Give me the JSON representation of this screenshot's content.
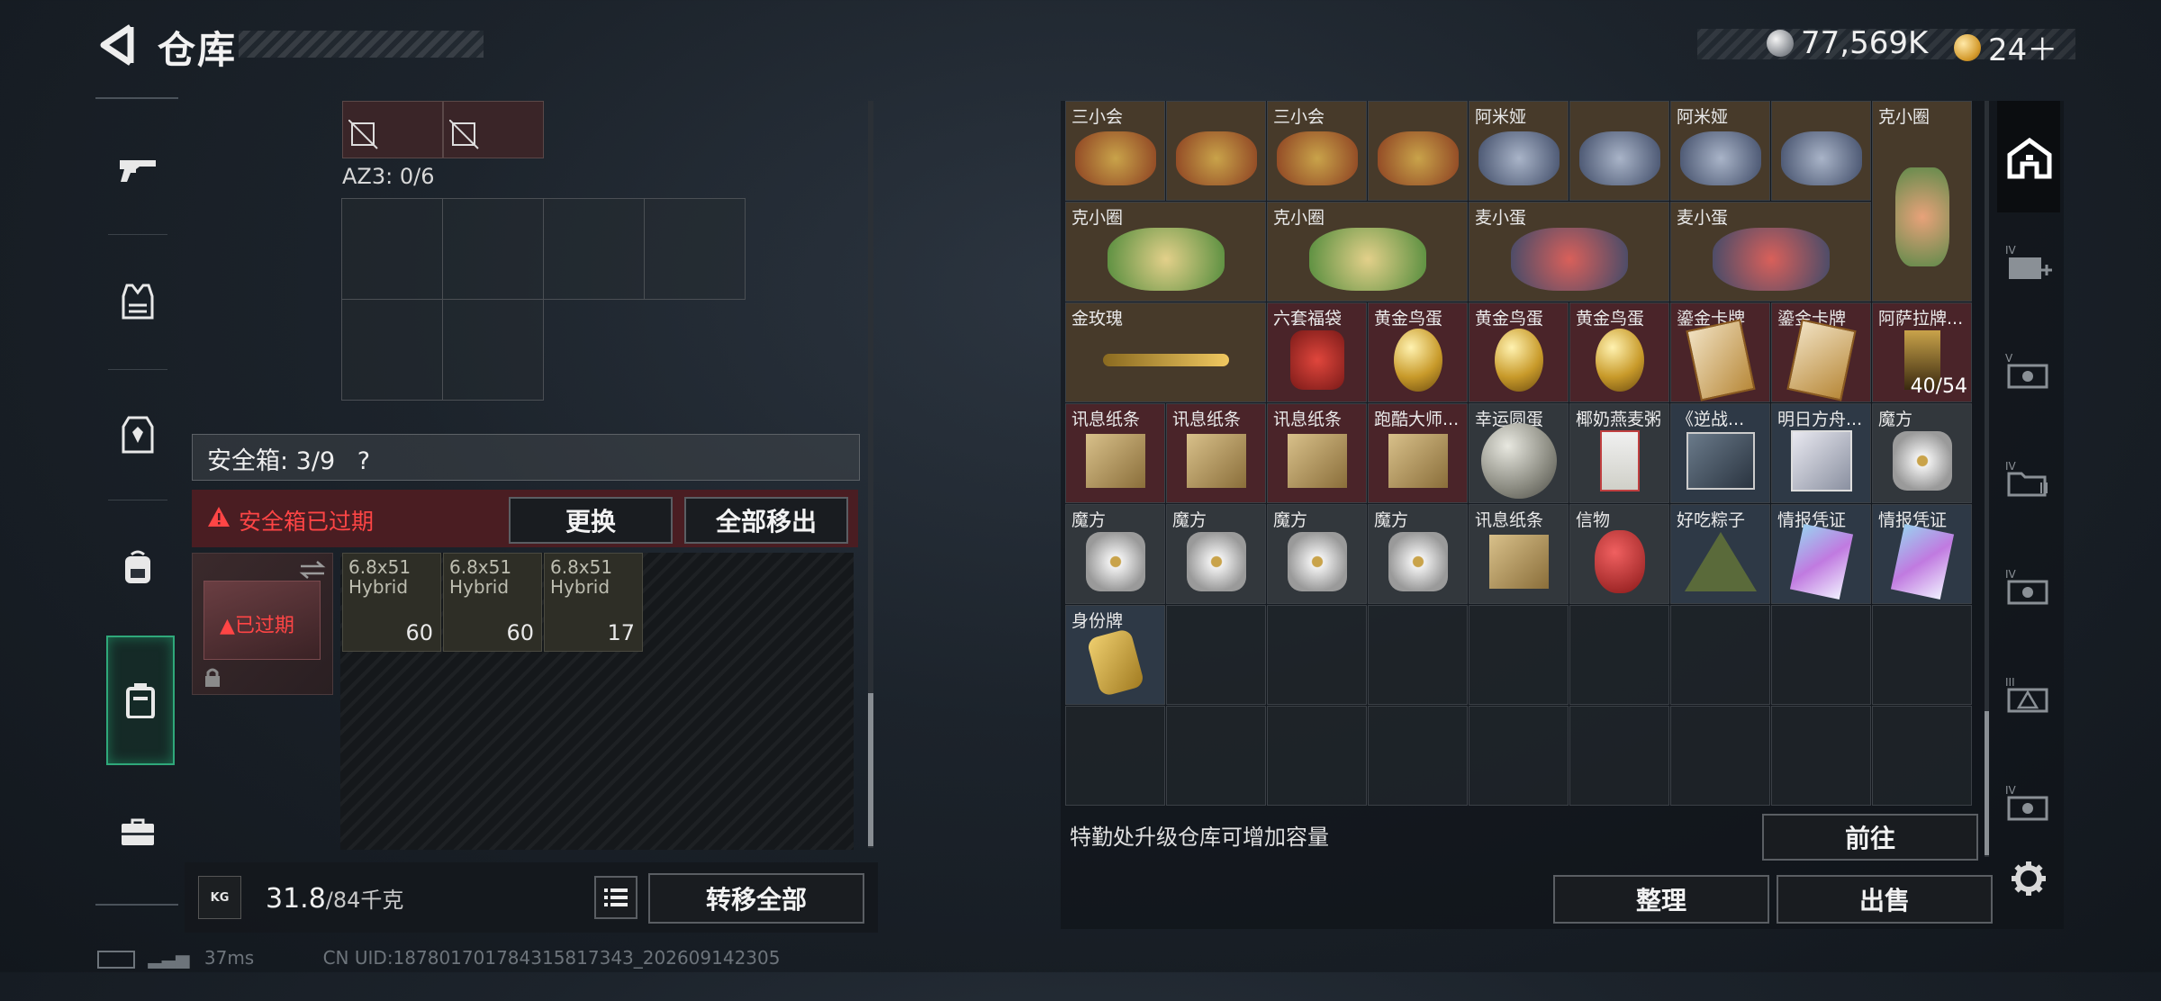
{
  "header": {
    "title": "仓库",
    "currency_silver": "77,569K",
    "currency_gold": "24＋"
  },
  "left_nav": {
    "items": [
      "gun-icon",
      "armor-vest-icon",
      "chest-rig-icon",
      "backpack-icon",
      "safebox-icon",
      "toolbox-icon"
    ]
  },
  "loadout": {
    "az3_label": "AZ3: 0/6",
    "safebox_label": "安全箱: 3/9",
    "safebox_help": "?",
    "expired_warning": "安全箱已过期",
    "replace_button": "更换",
    "move_all_out_button": "全部移出",
    "safebox_expired_tag": "已过期",
    "ammo": [
      {
        "name": "6.8x51\nHybrid",
        "count": "60"
      },
      {
        "name": "6.8x51\nHybrid",
        "count": "60"
      },
      {
        "name": "6.8x51\nHybrid",
        "count": "17"
      }
    ],
    "weight_value": "31.8",
    "weight_max": "/84千克",
    "weight_icon_text": "KG",
    "transfer_all_button": "转移全部"
  },
  "status": {
    "ping": "37ms",
    "uid": "CN UID:187801701784315817343_202609142305"
  },
  "inventory": {
    "rows": [
      [
        "三小会",
        "三小会",
        "阿米娅",
        "阿米娅",
        "克小圈"
      ],
      [
        "克小圈",
        "克小圈",
        "麦小蛋",
        "麦小蛋"
      ],
      [
        "金玫瑰",
        "六套福袋",
        "黄金鸟蛋",
        "黄金鸟蛋",
        "黄金鸟蛋",
        "鎏金卡牌",
        "鎏金卡牌",
        "阿萨拉牌..."
      ],
      [
        "讯息纸条",
        "讯息纸条",
        "讯息纸条",
        "跑酷大师...",
        "幸运圆蛋",
        "椰奶燕麦粥",
        "《逆战...",
        "明日方舟...",
        "魔方"
      ],
      [
        "魔方",
        "魔方",
        "魔方",
        "魔方",
        "讯息纸条",
        "信物",
        "好吃粽子",
        "情报凭证",
        "情报凭证"
      ],
      [
        "身份牌"
      ]
    ],
    "tall_item_count": "40/54",
    "upgrade_hint": "特勤处升级仓库可增加容量",
    "goto_button": "前往",
    "sort_button": "整理",
    "sell_button": "出售"
  },
  "right_tabs": [
    "warehouse-home-icon",
    "iv-add-icon",
    "v-camera-icon",
    "iv-folder-icon",
    "iv-camera-icon",
    "iii-warning-icon",
    "iv-camera-icon-2",
    "settings-gear-icon"
  ]
}
